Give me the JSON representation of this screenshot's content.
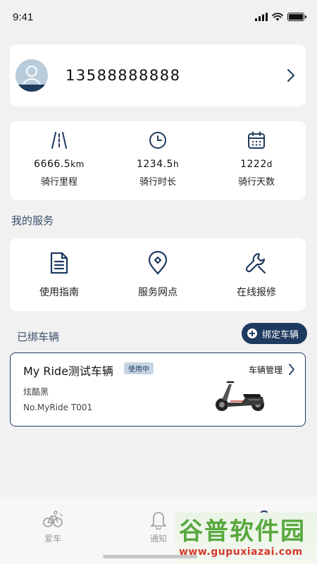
{
  "status_bar": {
    "time": "9:41"
  },
  "profile": {
    "phone": "13588888888"
  },
  "stats": [
    {
      "value": "6666.5",
      "unit": "km",
      "label": "骑行里程",
      "icon": "road-icon"
    },
    {
      "value": "1234.5",
      "unit": "h",
      "label": "骑行时长",
      "icon": "clock-icon"
    },
    {
      "value": "1222",
      "unit": "d",
      "label": "骑行天数",
      "icon": "calendar-icon"
    }
  ],
  "services": {
    "title": "我的服务",
    "items": [
      {
        "label": "使用指南",
        "icon": "document-icon"
      },
      {
        "label": "服务网点",
        "icon": "location-pin-icon"
      },
      {
        "label": "在线报修",
        "icon": "wrench-icon"
      }
    ]
  },
  "vehicles": {
    "title": "已绑车辆",
    "bind_label": "绑定车辆",
    "vehicle": {
      "name": "My Ride测试车辆",
      "status": "使用中",
      "color": "炫酷黑",
      "id": "No.MyRide T001",
      "manage_label": "车辆管理",
      "image": "scooter-image"
    }
  },
  "tabbar": [
    {
      "label": "爱车",
      "icon": "bike-icon"
    },
    {
      "label": "通知",
      "icon": "bell-icon"
    },
    {
      "label": "",
      "icon": "user-icon"
    }
  ],
  "watermark": {
    "title": "谷普软件园",
    "url": "www.gupuxiazai.com"
  },
  "colors": {
    "brand": "#1f3a5f",
    "background": "#f1f1f1",
    "badge": "#c6d6e4"
  }
}
